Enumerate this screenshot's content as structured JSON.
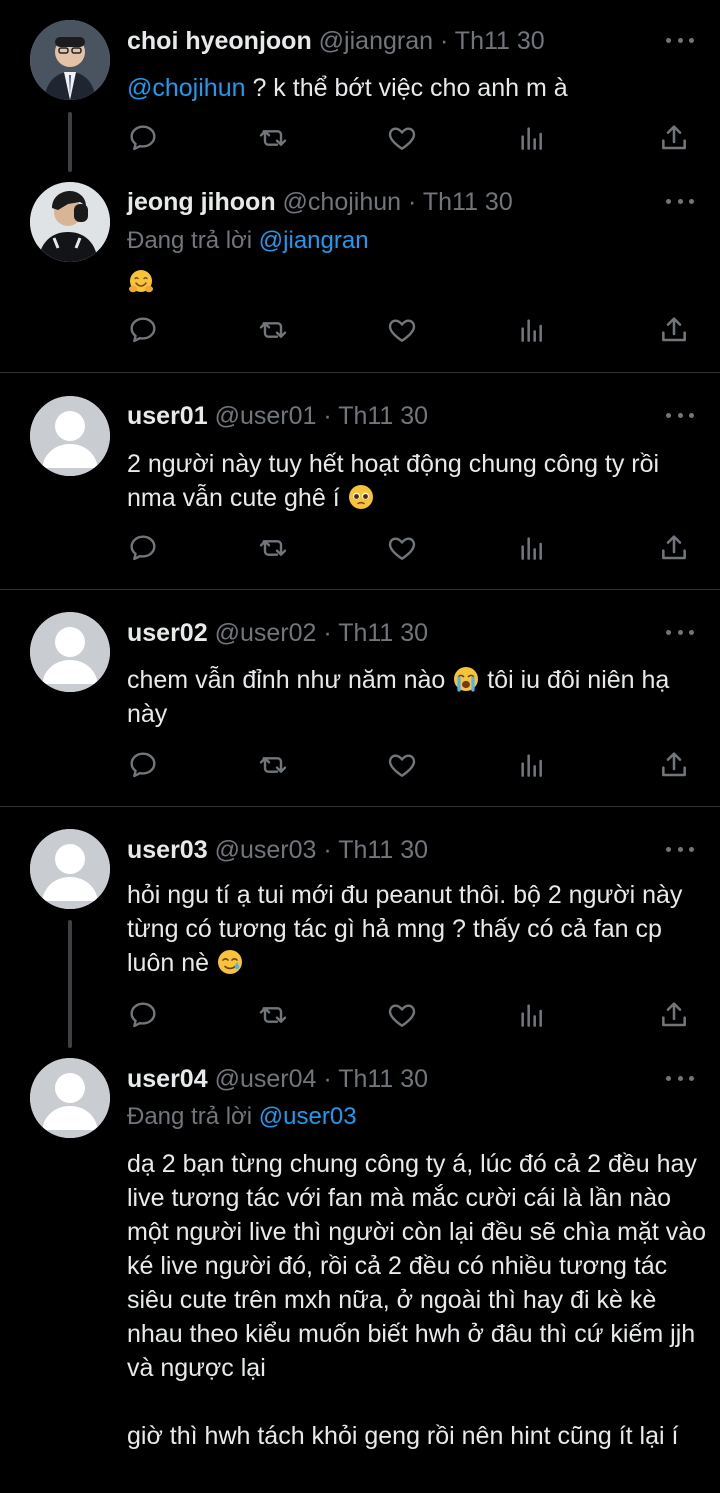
{
  "tweets": [
    {
      "name": "choi hyeonjoon",
      "handle": "@jiangran",
      "dot": "·",
      "time": "Th11 30",
      "mention": "@chojihun",
      "text": " ? k thể bớt việc cho anh m à"
    },
    {
      "name": "jeong jihoon",
      "handle": "@chojihun",
      "dot": "·",
      "time": "Th11 30",
      "replying_prefix": "Đang trả lời ",
      "replying_to": "@jiangran",
      "emoji": "hugging-face"
    },
    {
      "name": "user01",
      "handle": "@user01",
      "dot": "·",
      "time": "Th11 30",
      "text": "2 người này tuy hết hoạt động chung công ty rồi nma vẫn cute ghê í ",
      "emoji": "pleading-face"
    },
    {
      "name": "user02",
      "handle": "@user02",
      "dot": "·",
      "time": "Th11 30",
      "text_a": "chem vẫn đỉnh như năm nào ",
      "emoji": "loudly-crying-face",
      "text_b": " tôi iu đôi niên hạ này"
    },
    {
      "name": "user03",
      "handle": "@user03",
      "dot": "·",
      "time": "Th11 30",
      "text": "hỏi ngu tí ạ tui mới đu peanut thôi. bộ 2 người này từng có tương tác gì hả mng ? thấy có cả fan cp luôn nè ",
      "emoji": "smiling-face-with-tear"
    },
    {
      "name": "user04",
      "handle": "@user04",
      "dot": "·",
      "time": "Th11 30",
      "replying_prefix": "Đang trả lời ",
      "replying_to": "@user03",
      "text_p1": "dạ 2 bạn từng chung công ty á, lúc đó cả 2 đều hay live tương tác với fan mà mắc cười cái là lần nào một người live thì người còn lại đều sẽ chìa mặt vào ké live người đó, rồi cả 2 đều có nhiều tương tác siêu cute trên mxh nữa, ở ngoài thì hay đi kè kè nhau theo kiểu muốn biết hwh ở đâu thì cứ kiếm jjh và ngược lại",
      "text_p2": "giờ thì hwh tách khỏi geng rồi nên hint cũng ít lại í"
    }
  ],
  "icons": [
    "reply-icon",
    "retweet-icon",
    "like-icon",
    "views-icon",
    "share-icon",
    "more-icon"
  ],
  "colors": {
    "background": "#000000",
    "text": "#e7e9ea",
    "muted": "#71767b",
    "link": "#1d9bf0",
    "divider": "#2f3336",
    "thread_line": "#3e4144"
  }
}
